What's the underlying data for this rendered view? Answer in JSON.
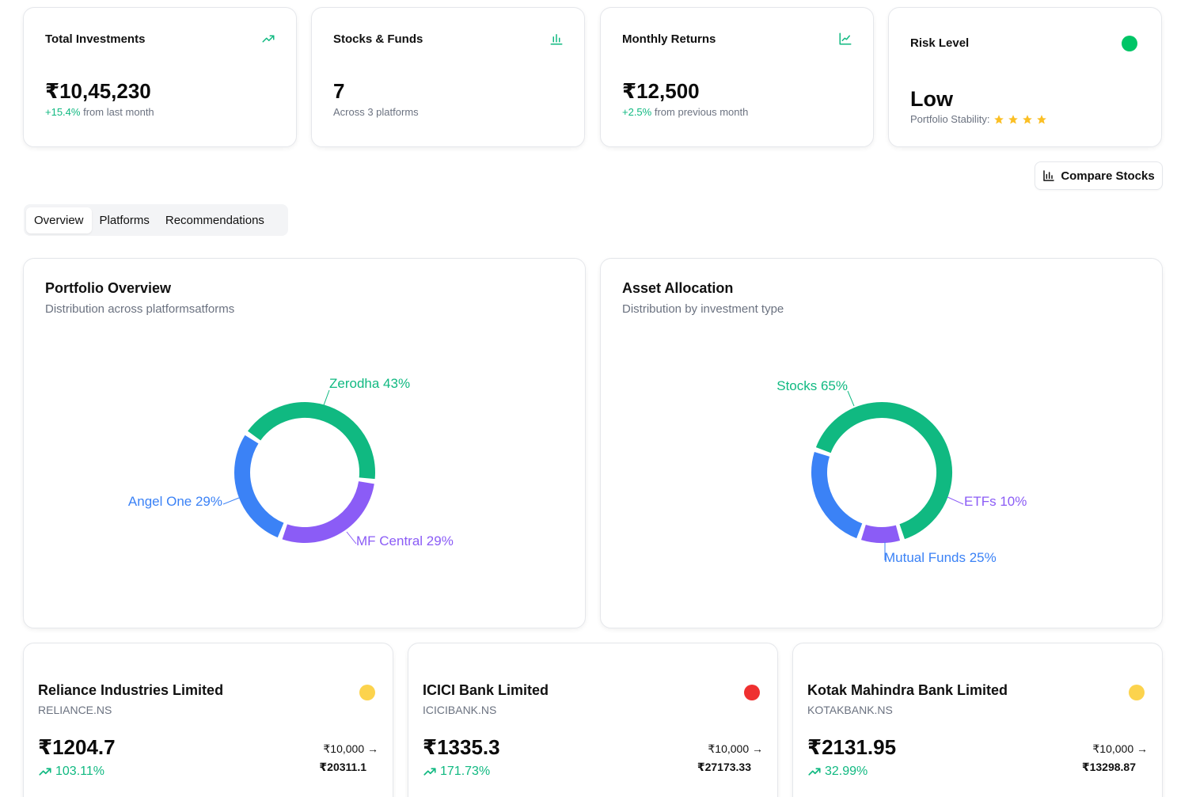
{
  "stats": {
    "total_investments": {
      "title": "Total Investments",
      "value": "₹10,45,230",
      "change": "+15.4%",
      "change_suffix": "from last month",
      "icon": "trending-up-icon"
    },
    "stocks_funds": {
      "title": "Stocks & Funds",
      "value": "7",
      "sub": "Across 3 platforms",
      "icon": "bar-chart-icon"
    },
    "monthly_returns": {
      "title": "Monthly Returns",
      "value": "₹12,500",
      "change": "+2.5%",
      "change_suffix": "from previous month",
      "icon": "line-chart-icon"
    },
    "risk_level": {
      "title": "Risk Level",
      "value": "Low",
      "sub": "Portfolio Stability:",
      "stars": 4,
      "status_color": "#00c566"
    }
  },
  "compare_button": {
    "label": "Compare Stocks",
    "icon": "bar-chart-icon"
  },
  "tabs": [
    {
      "label": "Overview",
      "active": true
    },
    {
      "label": "Platforms",
      "active": false
    },
    {
      "label": "Recommendations",
      "active": false
    }
  ],
  "portfolio_overview": {
    "title": "Portfolio Overview",
    "subtitle": "Distribution across platformsatforms"
  },
  "asset_allocation": {
    "title": "Asset Allocation",
    "subtitle": "Distribution by investment type"
  },
  "chart_data": [
    {
      "type": "pie",
      "title": "Portfolio Overview",
      "categories": [
        "Zerodha",
        "MF Central",
        "Angel One"
      ],
      "values": [
        43,
        29,
        29
      ],
      "labels": [
        "Zerodha 43%",
        "MF Central 29%",
        "Angel One 29%"
      ],
      "colors": [
        "#10b981",
        "#8b5cf6",
        "#3b82f6"
      ]
    },
    {
      "type": "pie",
      "title": "Asset Allocation",
      "categories": [
        "Stocks",
        "ETFs",
        "Mutual Funds"
      ],
      "values": [
        65,
        10,
        25
      ],
      "labels": [
        "Stocks 65%",
        "ETFs 10%",
        "Mutual Funds 25%"
      ],
      "colors": [
        "#10b981",
        "#8b5cf6",
        "#3b82f6"
      ]
    }
  ],
  "stocks": [
    {
      "name": "Reliance Industries Limited",
      "ticker": "RELIANCE.NS",
      "price": "₹1204.7",
      "change": "103.11%",
      "invested": "₹10,000 →",
      "final": "₹20311.1",
      "status_color": "#fcd34d"
    },
    {
      "name": "ICICI Bank Limited",
      "ticker": "ICICIBANK.NS",
      "price": "₹1335.3",
      "change": "171.73%",
      "invested": "₹10,000 →",
      "final": "₹27173.33",
      "status_color": "#ef3030"
    },
    {
      "name": "Kotak Mahindra Bank Limited",
      "ticker": "KOTAKBANK.NS",
      "price": "₹2131.95",
      "change": "32.99%",
      "invested": "₹10,000 →",
      "final": "₹13298.87",
      "status_color": "#fcd34d"
    }
  ]
}
